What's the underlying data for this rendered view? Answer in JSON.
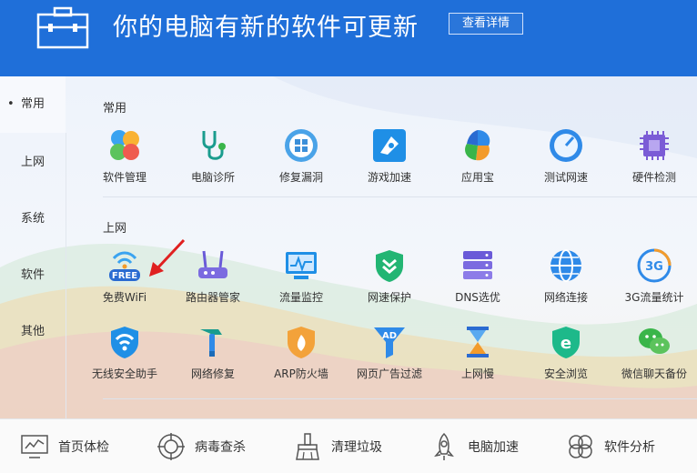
{
  "banner": {
    "title": "你的电脑有新的软件可更新",
    "details_label": "查看详情"
  },
  "sidebar": {
    "items": [
      {
        "label": "常用",
        "active": true
      },
      {
        "label": "上网"
      },
      {
        "label": "系统"
      },
      {
        "label": "软件"
      },
      {
        "label": "其他"
      }
    ],
    "bullet": "•"
  },
  "sections": {
    "common": {
      "title": "常用",
      "tools": [
        {
          "label": "软件管理",
          "icon": "software-manager-icon"
        },
        {
          "label": "电脑诊所",
          "icon": "stethoscope-icon"
        },
        {
          "label": "修复漏洞",
          "icon": "repair-patch-icon"
        },
        {
          "label": "游戏加速",
          "icon": "game-boost-icon"
        },
        {
          "label": "应用宝",
          "icon": "app-store-icon"
        },
        {
          "label": "测试网速",
          "icon": "speedometer-icon"
        },
        {
          "label": "硬件检测",
          "icon": "chip-icon"
        }
      ]
    },
    "internet": {
      "title": "上网",
      "row1": [
        {
          "label": "免费WiFi",
          "icon": "free-wifi-icon",
          "badge": "FREE"
        },
        {
          "label": "路由器管家",
          "icon": "router-icon"
        },
        {
          "label": "流量监控",
          "icon": "traffic-monitor-icon"
        },
        {
          "label": "网速保护",
          "icon": "shield-speed-icon"
        },
        {
          "label": "DNS选优",
          "icon": "dns-server-icon"
        },
        {
          "label": "网络连接",
          "icon": "globe-icon"
        },
        {
          "label": "3G流量统计",
          "icon": "3g-icon",
          "badge": "3G"
        }
      ],
      "row2": [
        {
          "label": "无线安全助手",
          "icon": "wifi-shield-icon"
        },
        {
          "label": "网络修复",
          "icon": "hammer-icon"
        },
        {
          "label": "ARP防火墙",
          "icon": "firewall-icon"
        },
        {
          "label": "网页广告过滤",
          "icon": "ad-filter-icon",
          "badge": "AD"
        },
        {
          "label": "上网慢",
          "icon": "hourglass-icon"
        },
        {
          "label": "安全浏览",
          "icon": "safe-browser-icon"
        },
        {
          "label": "微信聊天备份",
          "icon": "wechat-icon"
        }
      ]
    }
  },
  "bottom_nav": [
    {
      "label": "首页体检",
      "icon": "monitor-chart-icon"
    },
    {
      "label": "病毒查杀",
      "icon": "crosshair-icon"
    },
    {
      "label": "清理垃圾",
      "icon": "broom-icon"
    },
    {
      "label": "电脑加速",
      "icon": "rocket-icon"
    },
    {
      "label": "软件分析",
      "icon": "pinwheel-icon"
    }
  ]
}
